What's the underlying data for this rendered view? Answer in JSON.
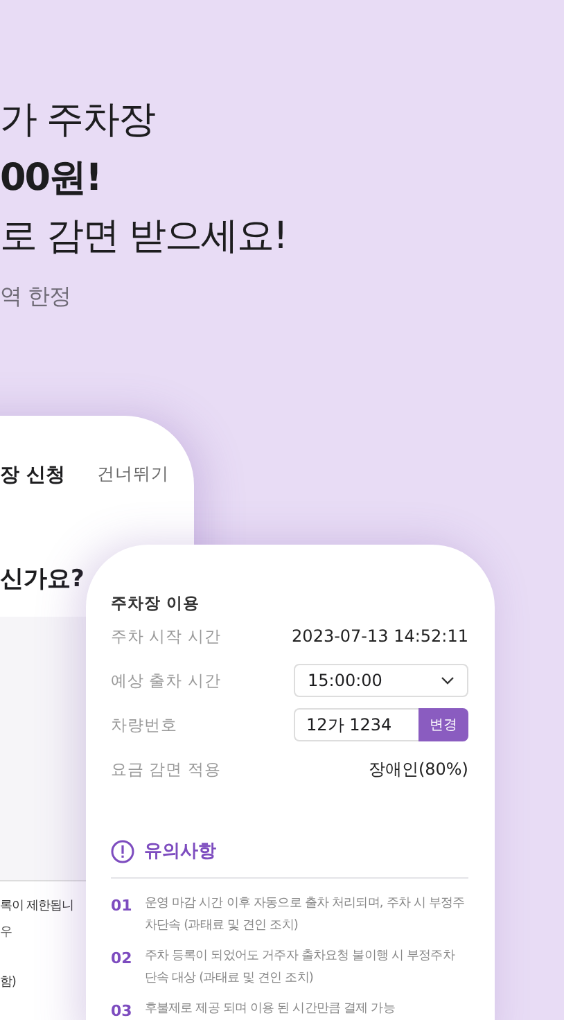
{
  "headline": [
    {
      "text": "가 주차장",
      "bold": false
    },
    {
      "text": "00원!",
      "bold": true
    },
    {
      "text": "로 감면 받으세요!",
      "bold": false
    }
  ],
  "subtitle": "역 한정",
  "back_screen": {
    "title": "장 신청",
    "skip": "건너뛰기",
    "question": "신가요?",
    "notes": [
      "록이 제한됩니",
      "우",
      "함)"
    ]
  },
  "front_screen": {
    "title": "주차장 이용",
    "rows": [
      {
        "kind": "text",
        "label": "주차 시작 시간",
        "value": "2023-07-13 14:52:11"
      },
      {
        "kind": "select",
        "label": "예상 출차 시간",
        "value": "15:00:00"
      },
      {
        "kind": "plate",
        "label": "차량번호",
        "value": "12가 1234",
        "button": "변경"
      },
      {
        "kind": "text",
        "label": "요금 감면 적용",
        "value": "장애인(80%)"
      }
    ],
    "notice_title": "유의사항",
    "notices": [
      {
        "number": "01",
        "text": "운영 마감 시간 이후 자동으로 출차 처리되며, 주차 시 부정주차단속 (과태료 및 견인 조치)"
      },
      {
        "number": "02",
        "text": "주차 등록이 되었어도 거주자 출차요청 불이행 시 부정주차 단속 대상 (과태료 및 견인 조치)"
      },
      {
        "number": "03",
        "text": "후불제로 제공 되며 이용 된 시간만큼 결제 가능"
      }
    ]
  }
}
